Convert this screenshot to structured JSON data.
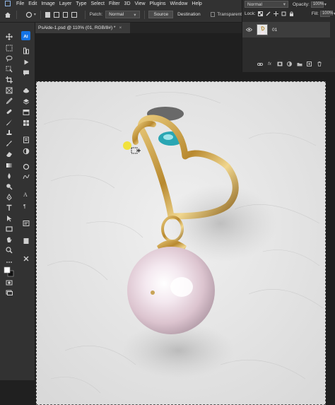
{
  "menubar": {
    "items": [
      "File",
      "Edit",
      "Image",
      "Layer",
      "Type",
      "Select",
      "Filter",
      "3D",
      "View",
      "Plugins",
      "Window",
      "Help"
    ]
  },
  "options": {
    "patch_label": "Patch:",
    "patch_mode": "Normal",
    "source_label": "Source",
    "destination_label": "Destination",
    "transparent_label": "Transparent"
  },
  "document": {
    "tab_title": "PsAide-1.psd @ 110% (01, RGB/8#) *",
    "close_glyph": "×"
  },
  "layers_panel": {
    "blend_mode": "Normal",
    "opacity_label": "Opacity:",
    "opacity_value": "100%",
    "lock_label": "Lock:",
    "fill_label": "Fill:",
    "fill_value": "100%",
    "layers": [
      {
        "name": "01",
        "visible": true
      }
    ],
    "footer_icons": [
      "link-icon",
      "fx-icon",
      "mask-icon",
      "adjustment-icon",
      "group-icon",
      "new-layer-icon",
      "trash-icon"
    ],
    "fx_label": "fx"
  },
  "colors": {
    "accent": "#1473e6",
    "gold": "#c9a24a",
    "pearl": "#f2e8ef"
  }
}
